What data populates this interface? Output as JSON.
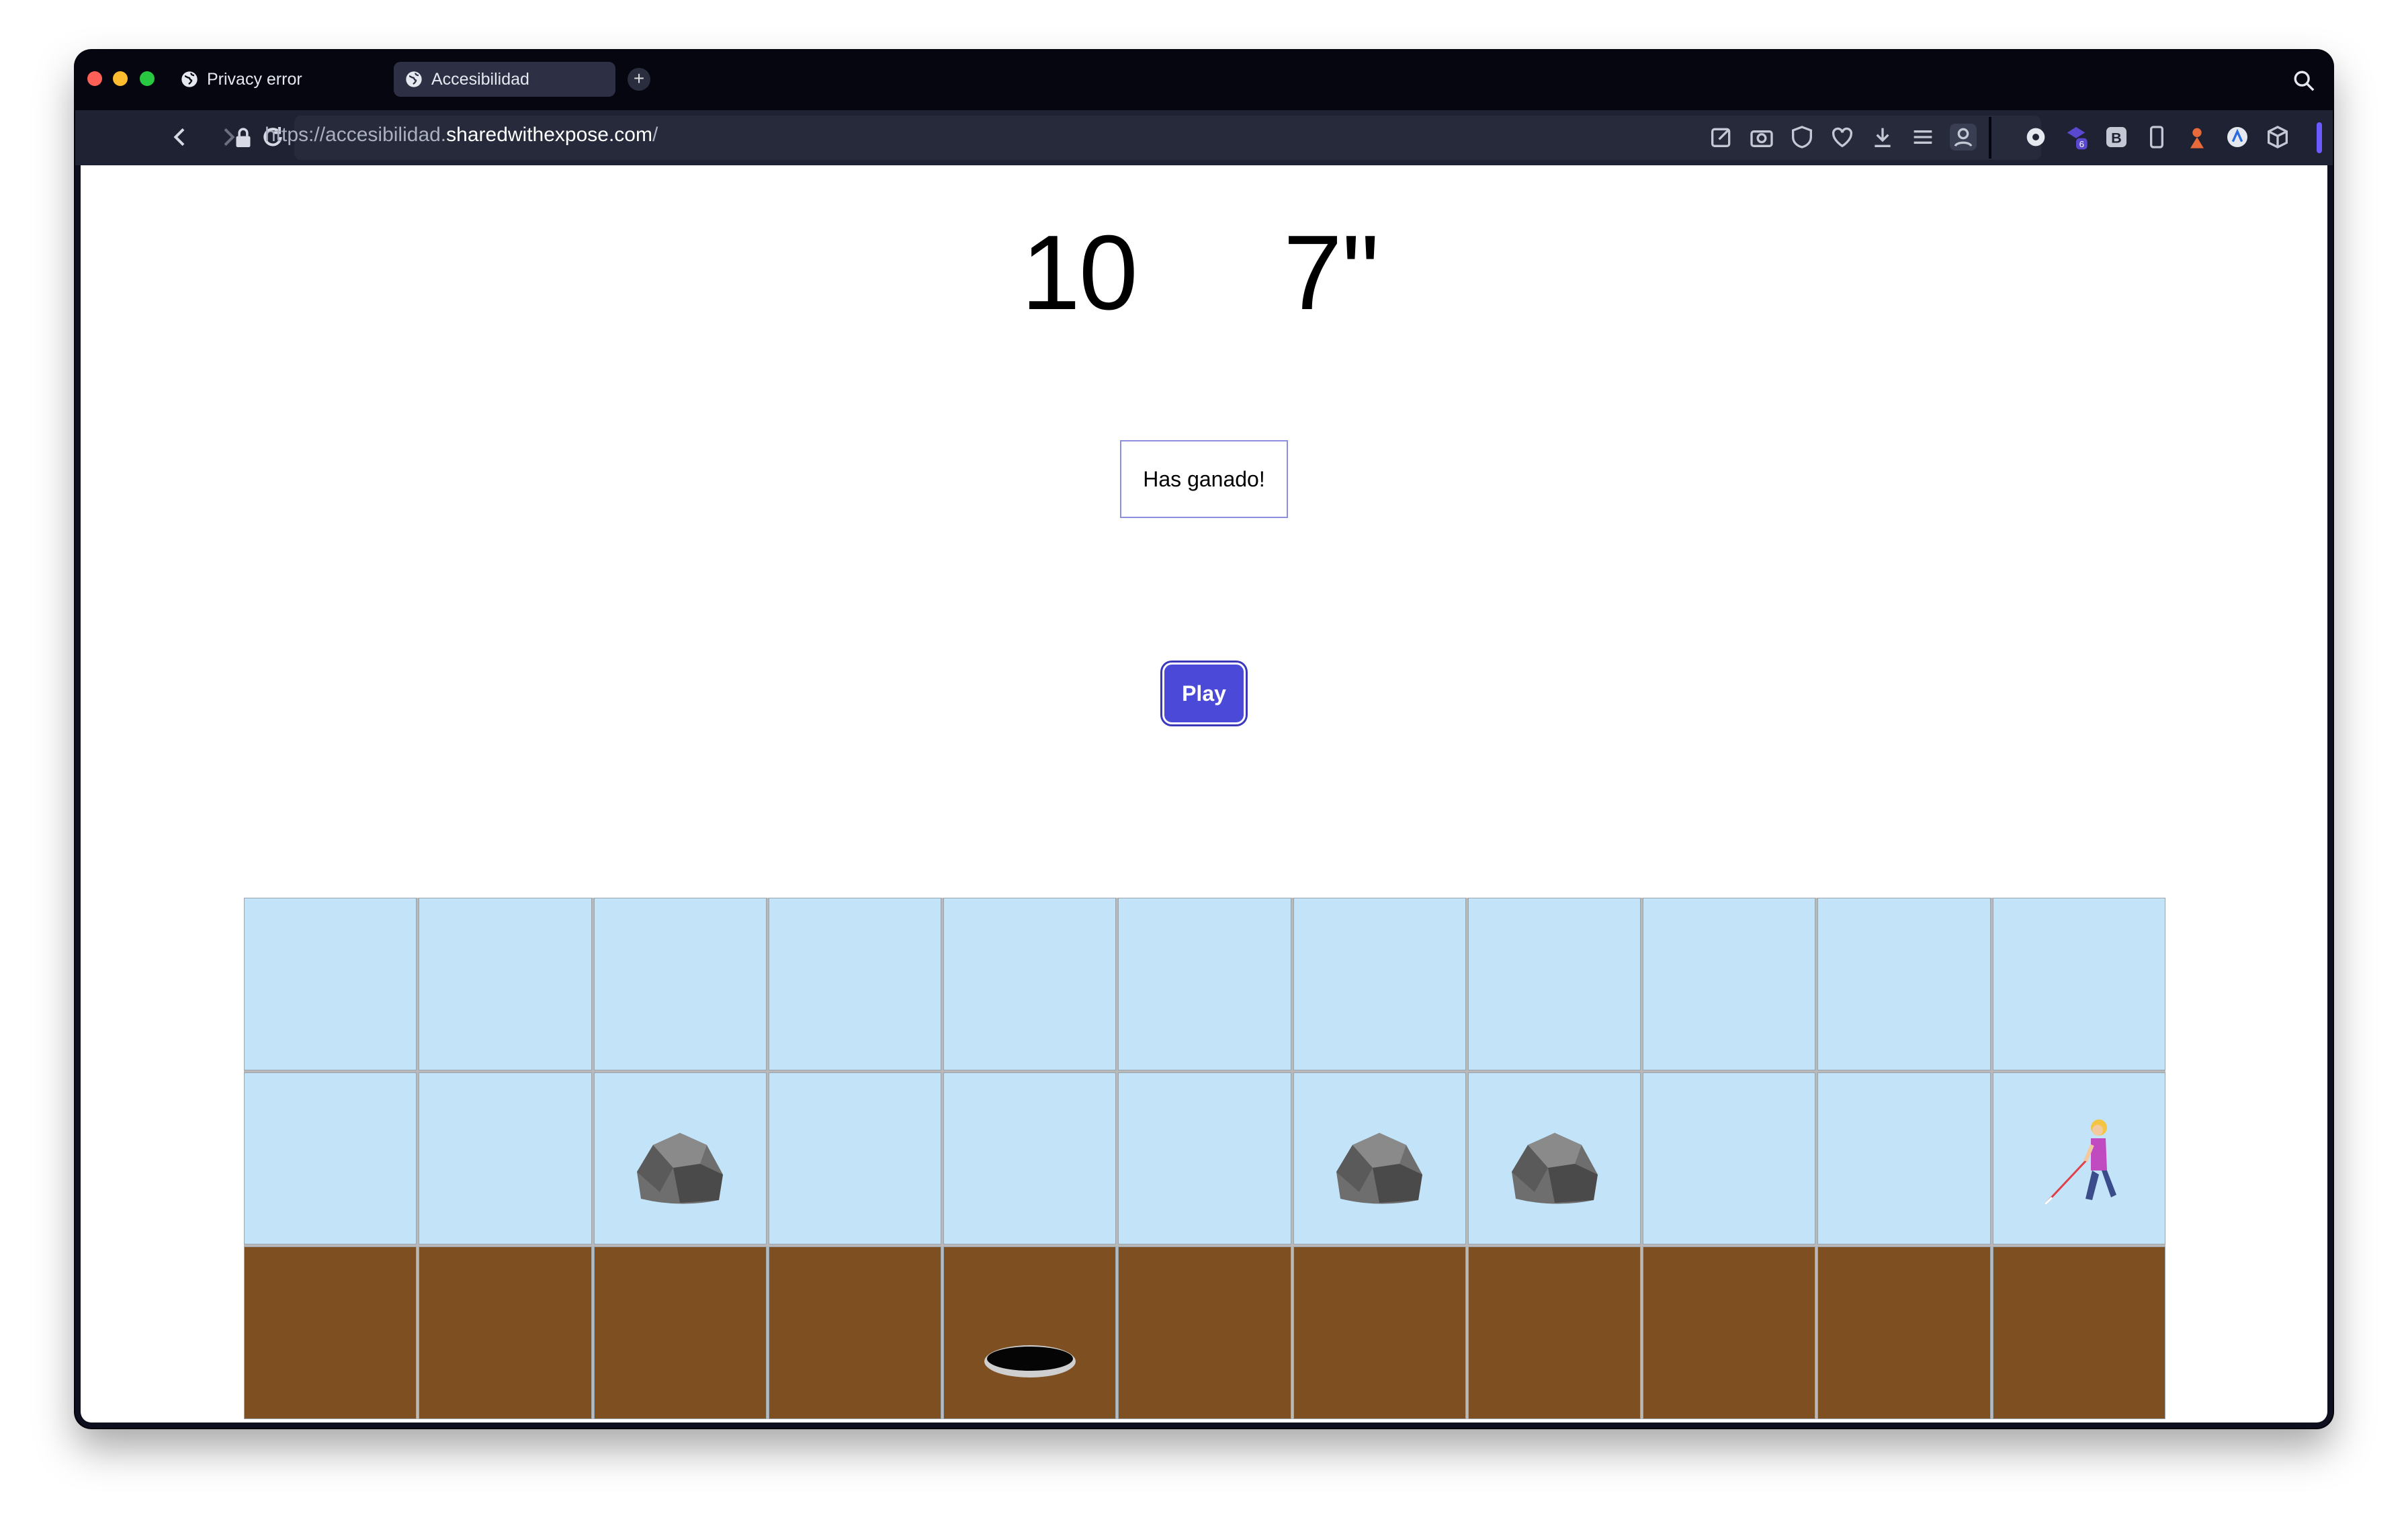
{
  "browser": {
    "tabs": [
      {
        "label": "Privacy error",
        "active": false
      },
      {
        "label": "Accesibilidad",
        "active": true
      }
    ],
    "new_tab_icon": "plus-icon",
    "url_prefix": "https://accesibilidad.",
    "url_host": "sharedwithexpose.com",
    "url_suffix": "/",
    "colors": {
      "chrome": "#05060f",
      "toolbar": "#1f2232",
      "active_tab": "#2d3044",
      "accent": "#6b5bff"
    },
    "extension_badge": "6"
  },
  "game": {
    "score_count": "10",
    "score_time": "7''",
    "message": "Has ganado!",
    "play_label": "Play",
    "colors": {
      "sky": "#c3e4f8",
      "ground": "#7e5021",
      "play_button": "#4b49d8"
    },
    "grid": {
      "columns": 11,
      "rows": [
        [
          "sky",
          "sky",
          "sky",
          "sky",
          "sky",
          "sky",
          "sky",
          "sky",
          "sky",
          "sky",
          "sky"
        ],
        [
          "sky",
          "sky",
          "rock",
          "sky",
          "sky",
          "sky",
          "rock",
          "rock",
          "sky",
          "sky",
          "person-with-cane"
        ],
        [
          "ground",
          "ground",
          "ground",
          "ground",
          "hole",
          "ground",
          "ground",
          "ground",
          "ground",
          "ground",
          "ground"
        ]
      ]
    }
  }
}
